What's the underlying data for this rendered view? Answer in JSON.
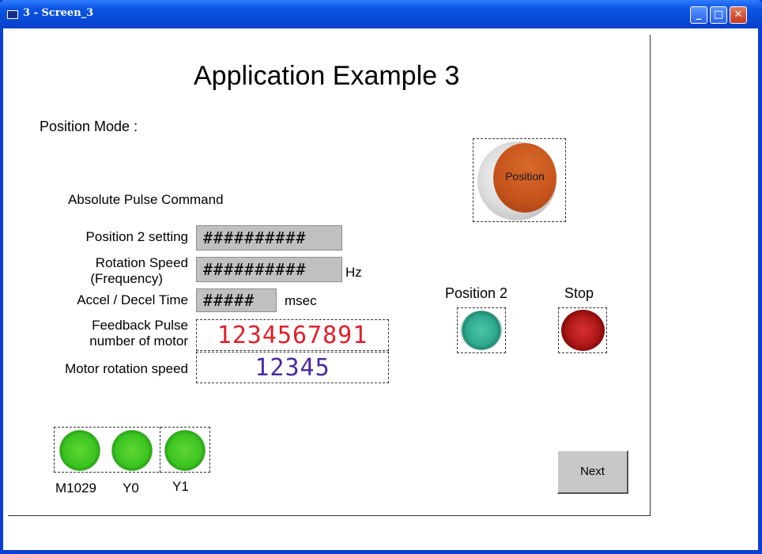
{
  "window": {
    "title": "3 - Screen_3",
    "min_label": "_",
    "max_label": "□",
    "close_label": "✕"
  },
  "screen": {
    "heading": "Application Example 3",
    "mode_label": "Position Mode :",
    "command_label": "Absolute Pulse Command",
    "fields": {
      "position2_label": "Position 2 setting",
      "position2_value": "##########",
      "speed_label_line1": "Rotation Speed",
      "speed_label_line2": "(Frequency)",
      "speed_value": "##########",
      "speed_unit": "Hz",
      "accel_label": "Accel / Decel Time",
      "accel_value": "#####",
      "accel_unit": "msec",
      "feedback_label_line1": "Feedback Pulse",
      "feedback_label_line2": "number of motor",
      "feedback_value": "1234567891",
      "rotation_label": "Motor rotation speed",
      "rotation_value": "12345"
    },
    "buttons": {
      "position": "Position",
      "position2": "Position 2",
      "stop": "Stop",
      "next": "Next"
    },
    "lamps": [
      {
        "label": "M1029"
      },
      {
        "label": "Y0"
      },
      {
        "label": "Y1"
      }
    ]
  },
  "colors": {
    "feedback_digits": "#e0202a",
    "rotation_digits": "#4a2aa0",
    "position_button": "#c8551c",
    "stop_button": "#b01818",
    "position2_button": "#2faa90"
  }
}
